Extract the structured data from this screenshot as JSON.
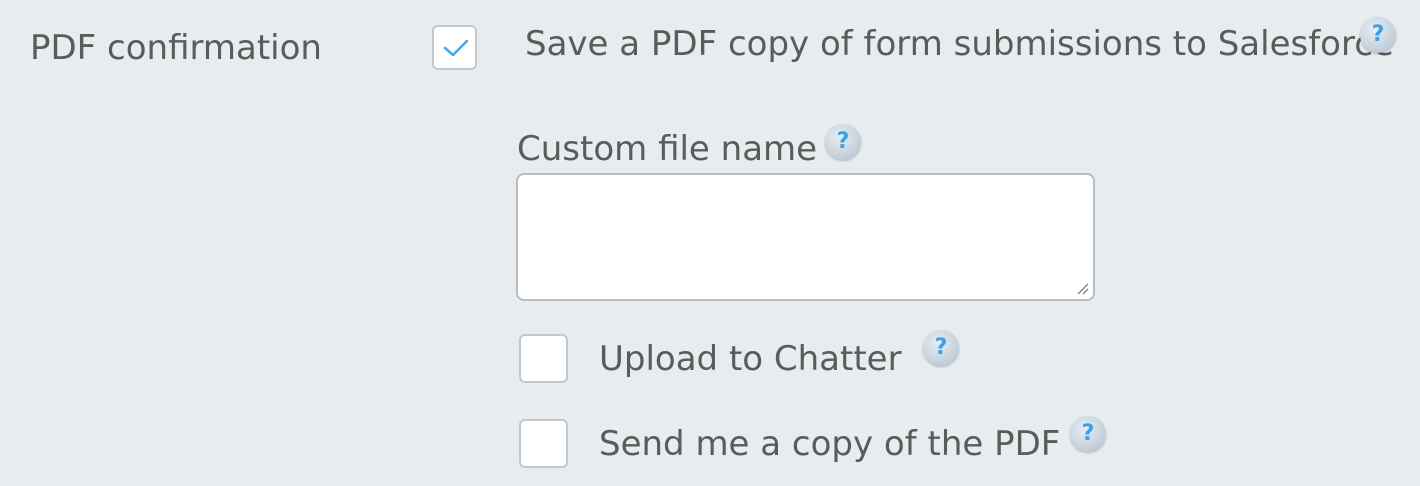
{
  "section_label": "PDF confirmation",
  "save_pdf": {
    "label": "Save a PDF copy of form submissions to Salesforce",
    "checked": true
  },
  "custom_file_name": {
    "label": "Custom file name",
    "value": ""
  },
  "upload_chatter": {
    "label": "Upload to Chatter",
    "checked": false
  },
  "send_copy": {
    "label": "Send me a copy of the PDF",
    "checked": false
  },
  "help_icon": {
    "symbol": "?",
    "icon": "question-mark-icon"
  },
  "colors": {
    "background": "#e7ecee",
    "text": "#5b5b5b",
    "check_accent": "#4aa7e8",
    "help_accent": "#3e9ee6"
  }
}
